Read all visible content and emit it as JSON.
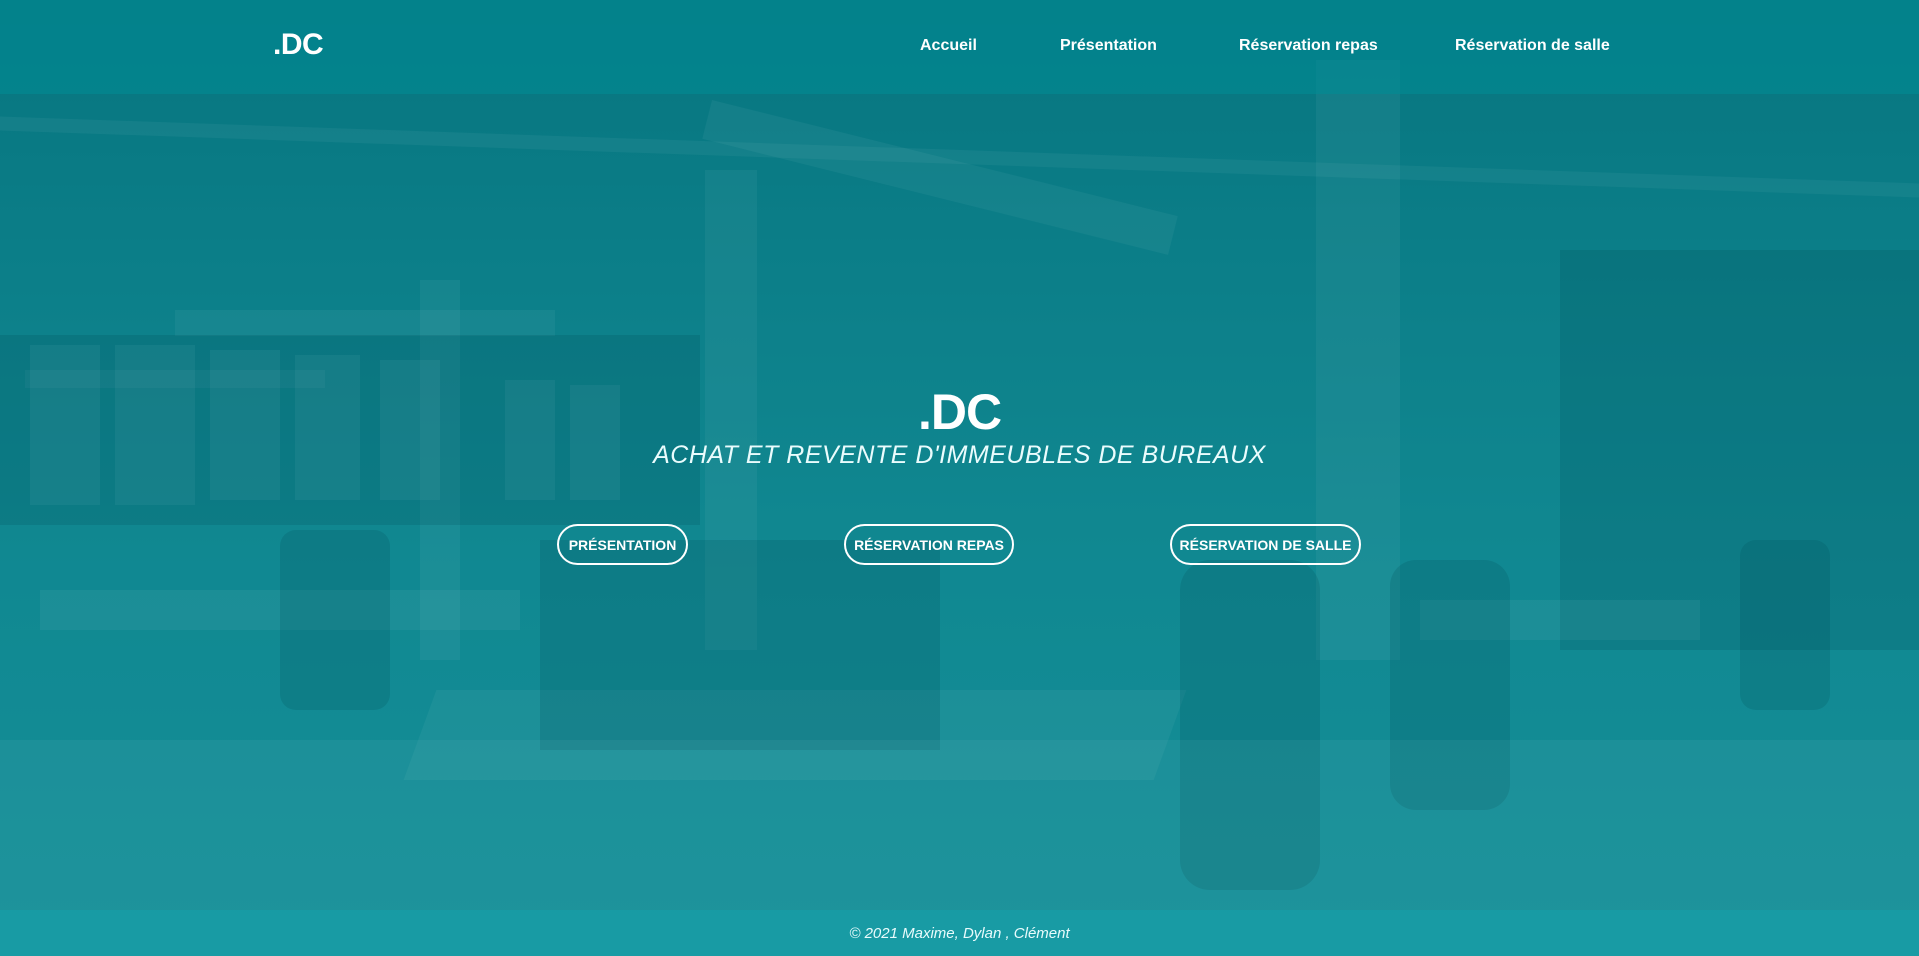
{
  "header": {
    "logo": ".DC",
    "nav": [
      {
        "label": "Accueil"
      },
      {
        "label": "Présentation"
      },
      {
        "label": "Réservation repas"
      },
      {
        "label": "Réservation de salle"
      }
    ]
  },
  "hero": {
    "title": ".DC",
    "subtitle": "ACHAT ET REVENTE D'IMMEUBLES DE BUREAUX",
    "buttons": [
      {
        "label": "PRÉSENTATION"
      },
      {
        "label": "RÉSERVATION REPAS"
      },
      {
        "label": "RÉSERVATION DE SALLE"
      }
    ]
  },
  "footer": {
    "copyright": "© 2021 Maxime, Dylan , Clément"
  },
  "colors": {
    "overlay": "#0f7f89",
    "header": "#0a8c96",
    "footer": "#1496a0",
    "text": "#ffffff"
  }
}
